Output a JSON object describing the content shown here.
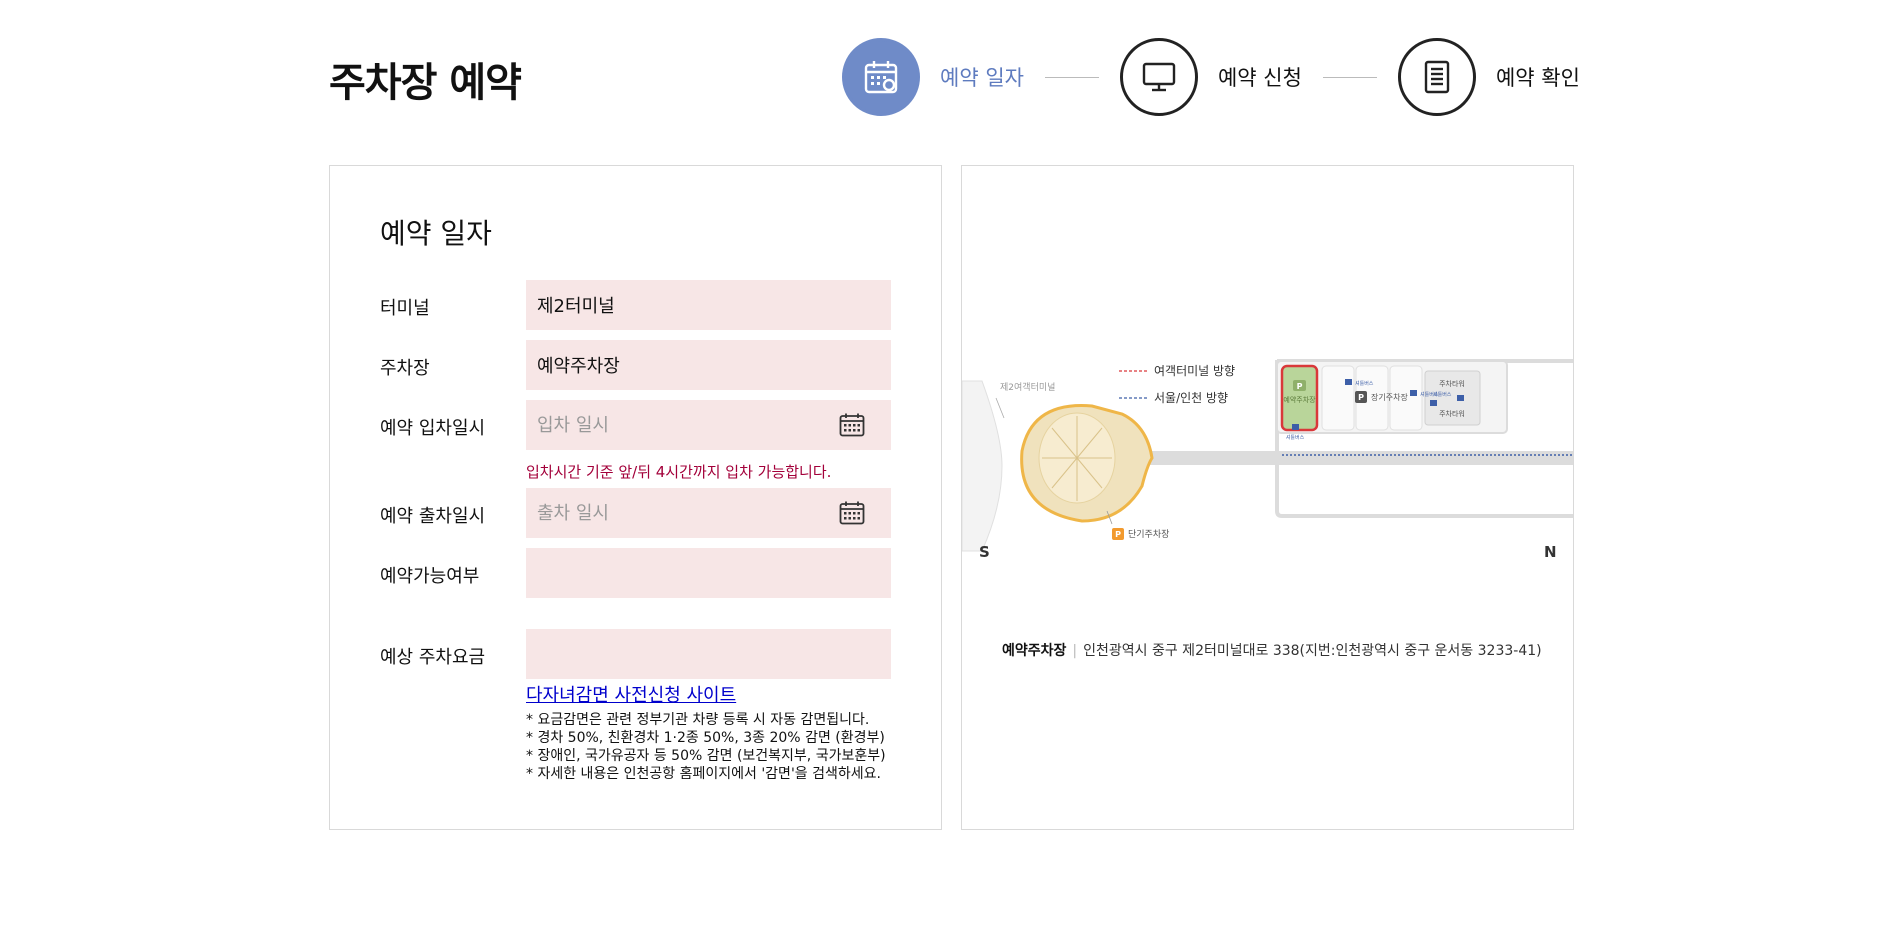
{
  "page": {
    "title": "주차장 예약"
  },
  "steps": [
    {
      "label": "예약 일자",
      "icon": "calendar-icon",
      "active": true
    },
    {
      "label": "예약 신청",
      "icon": "monitor-icon",
      "active": false
    },
    {
      "label": "예약 확인",
      "icon": "document-icon",
      "active": false
    }
  ],
  "form": {
    "section_title": "예약 일자",
    "terminal": {
      "label": "터미널",
      "value": "제2터미널"
    },
    "parking": {
      "label": "주차장",
      "value": "예약주차장"
    },
    "entry": {
      "label": "예약 입차일시",
      "placeholder": "입차 일시",
      "value": ""
    },
    "entry_note": "입차시간 기준 앞/뒤 4시간까지 입차 가능합니다.",
    "exit": {
      "label": "예약 출차일시",
      "placeholder": "출차 일시",
      "value": ""
    },
    "availability": {
      "label": "예약가능여부",
      "value": ""
    },
    "fee": {
      "label": "예상 주차요금",
      "value": ""
    },
    "discount_link": "다자녀감면 사전신청 사이트",
    "notes": [
      "* 요금감면은 관련 정부기관 차량 등록 시 자동 감면됩니다.",
      "* 경차 50%, 친환경차 1·2종 50%, 3종 20% 감면 (환경부)",
      "* 장애인, 국가유공자 등 50% 감면 (보건복지부, 국가보훈부)",
      "* 자세한 내용은 인천공항 홈페이지에서 '감면'을 검색하세요."
    ]
  },
  "map": {
    "legend": {
      "to_terminal": "여객터미널 방향",
      "to_seoul": "서울/인천 방향"
    },
    "labels": {
      "terminal2": "제2여객터미널",
      "reserved_lot": "예약주차장",
      "long_term": "장기주차장",
      "short_term": "단기주차장",
      "parking_tower": "주차타워",
      "shuttle_bus": "셔틀버스",
      "parking_badge": "P",
      "south": "S",
      "north": "N"
    },
    "colors": {
      "highlight_border": "#d9383a",
      "highlight_fill": "#b9d59a",
      "terminal_fill": "#f0e2bd",
      "terminal_border": "#efb648",
      "road": "#dcdcdc",
      "legend_red": "#d9383a",
      "legend_blue": "#3d5fa8"
    },
    "address_title": "예약주차장",
    "address": "인천광역시 중구 제2터미널대로 338(지번:인천광역시 중구 운서동 3233-41)"
  },
  "theme": {
    "accent": "#6f8bc8",
    "field_bg": "#f7e6e6",
    "note_color": "#a3003a"
  }
}
